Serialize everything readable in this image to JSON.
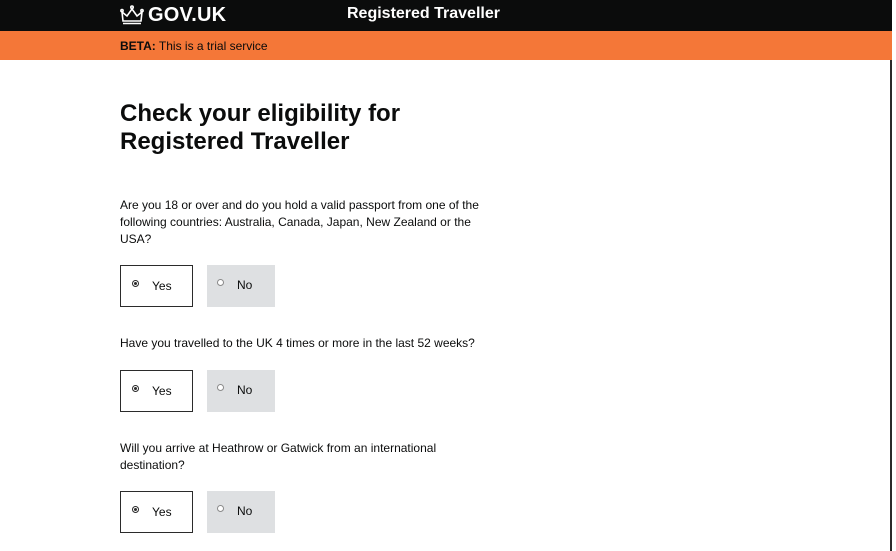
{
  "header": {
    "logo_text": "GOV.UK",
    "logo_icon": "crown-icon",
    "service_name": "Registered Traveller"
  },
  "beta": {
    "tag": "BETA:",
    "text": " This is a trial service"
  },
  "main": {
    "title_line1": "Check your eligibility for",
    "title_line2": "Registered Traveller",
    "questions": [
      {
        "text": "Are you 18 or over and do you hold a valid passport from one of the following countries: Australia, Canada, Japan, New Zealand or the USA?",
        "yes_label": "Yes",
        "no_label": "No",
        "selected": "Yes"
      },
      {
        "text": "Have you travelled to the UK 4 times or more in the last 52 weeks?",
        "yes_label": "Yes",
        "no_label": "No",
        "selected": "Yes"
      },
      {
        "text": "Will you arrive at Heathrow or Gatwick from an international destination?",
        "yes_label": "Yes",
        "no_label": "No",
        "selected": "Yes"
      }
    ]
  },
  "colors": {
    "header_bg": "#0b0c0c",
    "beta_bg": "#f47738",
    "unselected_option_bg": "#dee0e2"
  }
}
